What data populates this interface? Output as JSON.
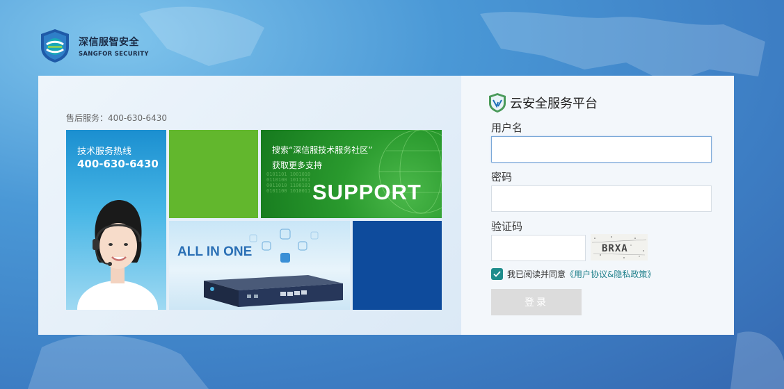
{
  "brand": {
    "name_cn": "深信服智安全",
    "name_en": "SANGFOR SECURITY"
  },
  "left": {
    "hotline_small": "售后服务：400-630-6430",
    "tile_hotline": {
      "line1": "技术服务热线",
      "line2": "400-630-6430"
    },
    "tile_support": {
      "line1": "搜索“深信服技术服务社区”",
      "line2": "获取更多支持",
      "big": "SUPPORT"
    },
    "tile_device": {
      "caption": "ALL IN ONE"
    }
  },
  "login": {
    "platform_title": "云安全服务平台",
    "username_label": "用户名",
    "username_value": "",
    "password_label": "密码",
    "password_value": "",
    "captcha_label": "验证码",
    "captcha_value": "",
    "captcha_image_text": "BRXA",
    "agree_text": "我已阅读并同意",
    "agree_link": "《用户协议&隐私政策》",
    "agree_checked": true,
    "submit_label": "登录"
  },
  "colors": {
    "accent_teal": "#1e8c8c",
    "bg_blue": "#3d7ec4",
    "tile_green": "#62b72d",
    "tile_navy": "#0e4b9c"
  }
}
